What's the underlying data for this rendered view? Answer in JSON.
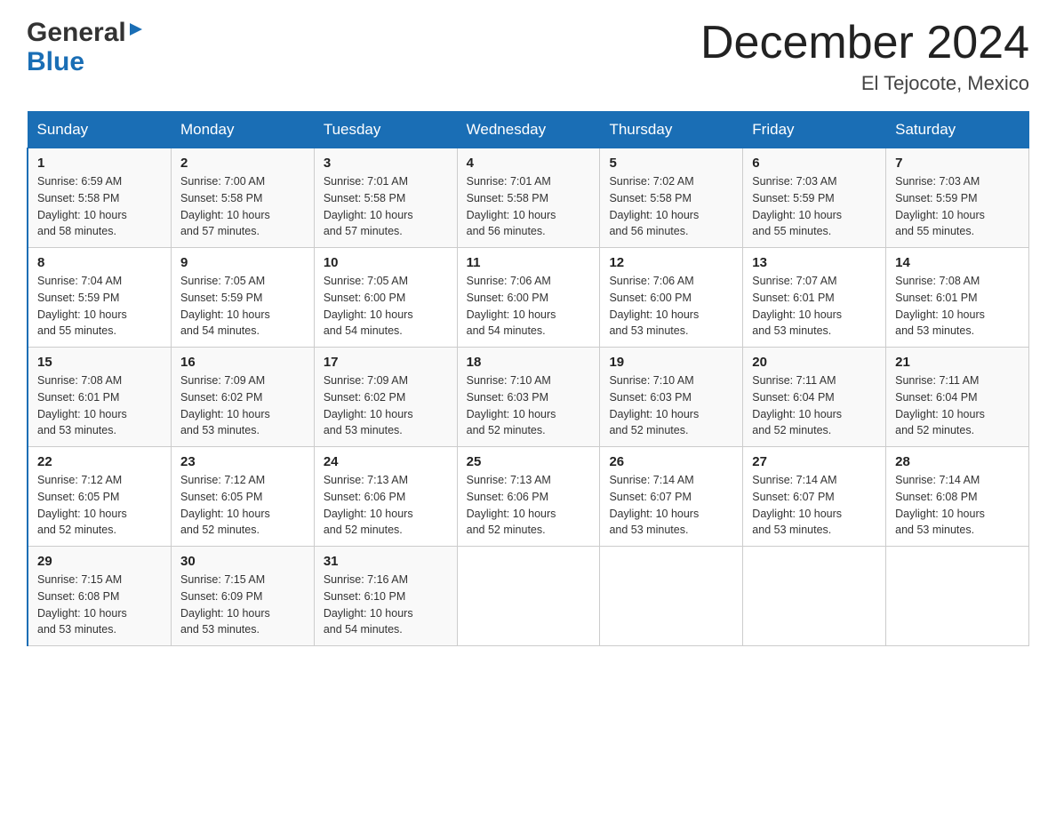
{
  "header": {
    "logo_general": "General",
    "logo_blue": "Blue",
    "month_title": "December 2024",
    "location": "El Tejocote, Mexico"
  },
  "days_of_week": [
    "Sunday",
    "Monday",
    "Tuesday",
    "Wednesday",
    "Thursday",
    "Friday",
    "Saturday"
  ],
  "weeks": [
    [
      {
        "day": "1",
        "sunrise": "6:59 AM",
        "sunset": "5:58 PM",
        "daylight": "10 hours and 58 minutes."
      },
      {
        "day": "2",
        "sunrise": "7:00 AM",
        "sunset": "5:58 PM",
        "daylight": "10 hours and 57 minutes."
      },
      {
        "day": "3",
        "sunrise": "7:01 AM",
        "sunset": "5:58 PM",
        "daylight": "10 hours and 57 minutes."
      },
      {
        "day": "4",
        "sunrise": "7:01 AM",
        "sunset": "5:58 PM",
        "daylight": "10 hours and 56 minutes."
      },
      {
        "day": "5",
        "sunrise": "7:02 AM",
        "sunset": "5:58 PM",
        "daylight": "10 hours and 56 minutes."
      },
      {
        "day": "6",
        "sunrise": "7:03 AM",
        "sunset": "5:59 PM",
        "daylight": "10 hours and 55 minutes."
      },
      {
        "day": "7",
        "sunrise": "7:03 AM",
        "sunset": "5:59 PM",
        "daylight": "10 hours and 55 minutes."
      }
    ],
    [
      {
        "day": "8",
        "sunrise": "7:04 AM",
        "sunset": "5:59 PM",
        "daylight": "10 hours and 55 minutes."
      },
      {
        "day": "9",
        "sunrise": "7:05 AM",
        "sunset": "5:59 PM",
        "daylight": "10 hours and 54 minutes."
      },
      {
        "day": "10",
        "sunrise": "7:05 AM",
        "sunset": "6:00 PM",
        "daylight": "10 hours and 54 minutes."
      },
      {
        "day": "11",
        "sunrise": "7:06 AM",
        "sunset": "6:00 PM",
        "daylight": "10 hours and 54 minutes."
      },
      {
        "day": "12",
        "sunrise": "7:06 AM",
        "sunset": "6:00 PM",
        "daylight": "10 hours and 53 minutes."
      },
      {
        "day": "13",
        "sunrise": "7:07 AM",
        "sunset": "6:01 PM",
        "daylight": "10 hours and 53 minutes."
      },
      {
        "day": "14",
        "sunrise": "7:08 AM",
        "sunset": "6:01 PM",
        "daylight": "10 hours and 53 minutes."
      }
    ],
    [
      {
        "day": "15",
        "sunrise": "7:08 AM",
        "sunset": "6:01 PM",
        "daylight": "10 hours and 53 minutes."
      },
      {
        "day": "16",
        "sunrise": "7:09 AM",
        "sunset": "6:02 PM",
        "daylight": "10 hours and 53 minutes."
      },
      {
        "day": "17",
        "sunrise": "7:09 AM",
        "sunset": "6:02 PM",
        "daylight": "10 hours and 53 minutes."
      },
      {
        "day": "18",
        "sunrise": "7:10 AM",
        "sunset": "6:03 PM",
        "daylight": "10 hours and 52 minutes."
      },
      {
        "day": "19",
        "sunrise": "7:10 AM",
        "sunset": "6:03 PM",
        "daylight": "10 hours and 52 minutes."
      },
      {
        "day": "20",
        "sunrise": "7:11 AM",
        "sunset": "6:04 PM",
        "daylight": "10 hours and 52 minutes."
      },
      {
        "day": "21",
        "sunrise": "7:11 AM",
        "sunset": "6:04 PM",
        "daylight": "10 hours and 52 minutes."
      }
    ],
    [
      {
        "day": "22",
        "sunrise": "7:12 AM",
        "sunset": "6:05 PM",
        "daylight": "10 hours and 52 minutes."
      },
      {
        "day": "23",
        "sunrise": "7:12 AM",
        "sunset": "6:05 PM",
        "daylight": "10 hours and 52 minutes."
      },
      {
        "day": "24",
        "sunrise": "7:13 AM",
        "sunset": "6:06 PM",
        "daylight": "10 hours and 52 minutes."
      },
      {
        "day": "25",
        "sunrise": "7:13 AM",
        "sunset": "6:06 PM",
        "daylight": "10 hours and 52 minutes."
      },
      {
        "day": "26",
        "sunrise": "7:14 AM",
        "sunset": "6:07 PM",
        "daylight": "10 hours and 53 minutes."
      },
      {
        "day": "27",
        "sunrise": "7:14 AM",
        "sunset": "6:07 PM",
        "daylight": "10 hours and 53 minutes."
      },
      {
        "day": "28",
        "sunrise": "7:14 AM",
        "sunset": "6:08 PM",
        "daylight": "10 hours and 53 minutes."
      }
    ],
    [
      {
        "day": "29",
        "sunrise": "7:15 AM",
        "sunset": "6:08 PM",
        "daylight": "10 hours and 53 minutes."
      },
      {
        "day": "30",
        "sunrise": "7:15 AM",
        "sunset": "6:09 PM",
        "daylight": "10 hours and 53 minutes."
      },
      {
        "day": "31",
        "sunrise": "7:16 AM",
        "sunset": "6:10 PM",
        "daylight": "10 hours and 54 minutes."
      },
      null,
      null,
      null,
      null
    ]
  ],
  "labels": {
    "sunrise": "Sunrise:",
    "sunset": "Sunset:",
    "daylight": "Daylight:"
  }
}
